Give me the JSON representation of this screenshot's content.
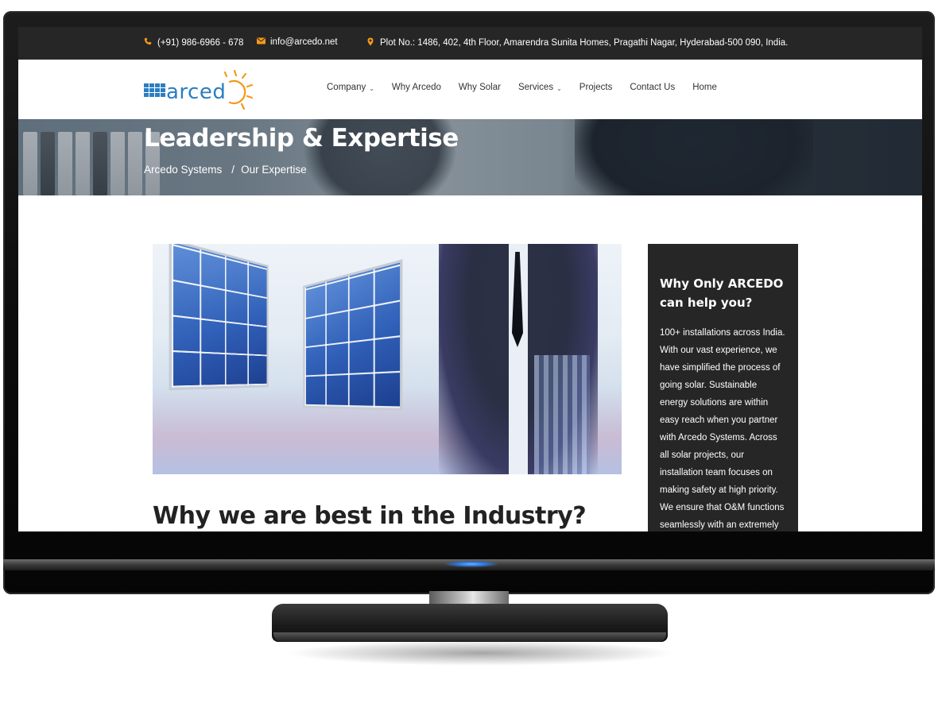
{
  "topbar": {
    "phone": "(+91) 986-6966 - 678",
    "email": "info@arcedo.net",
    "address": "Plot No.: 1486, 402, 4th Floor, Amarendra Sunita Homes, Pragathi Nagar, Hyderabad-500 090, India."
  },
  "brand": {
    "logo_text": "arced",
    "accent": "#f49a1a",
    "blue": "#2b7ec1"
  },
  "nav": {
    "items": [
      {
        "label": "Company",
        "dropdown": true
      },
      {
        "label": "Why Arcedo",
        "dropdown": false
      },
      {
        "label": "Why Solar",
        "dropdown": false
      },
      {
        "label": "Services",
        "dropdown": true
      },
      {
        "label": "Projects",
        "dropdown": false
      },
      {
        "label": "Contact Us",
        "dropdown": false
      },
      {
        "label": "Home",
        "dropdown": false
      }
    ]
  },
  "hero": {
    "title": "Leadership & Expertise",
    "breadcrumb": [
      "Arcedo Systems",
      "Our Expertise"
    ],
    "separator": "/"
  },
  "content": {
    "heading": "Why we are best in the Industry?"
  },
  "sidebar": {
    "title": "Why Only ARCEDO can help you?",
    "body": "100+ installations across India. With our vast experience, we have simplified the process of going solar. Sustainable energy solutions are within easy reach when you partner with Arcedo Systems. Across all solar projects, our installation team focuses on making safety at high priority. We ensure that O&M functions seamlessly with an extremely"
  }
}
